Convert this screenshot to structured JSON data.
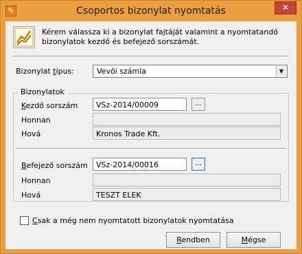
{
  "window": {
    "title": "Csoportos bizonylat nyomtatás",
    "close_glyph": "✕"
  },
  "info": {
    "icon": "chart-document-icon",
    "text": "Kérem válassza ki a bizonylat fajtáját valamint a nyomtatandó bizonylatok kezdő és befejező sorszámát."
  },
  "type_select": {
    "label_pre": "Bizonylat ",
    "label_accel": "t",
    "label_post": "ípus:",
    "value": "Vevői számla"
  },
  "group": {
    "title": "Bizonylatok",
    "start": {
      "label_accel": "K",
      "label_post": "ezdő sorszám",
      "value": "VSz-2014/00009",
      "browse_label": "...",
      "from_label": "Honnan",
      "from_value": "",
      "to_label": "Hová",
      "to_value": "Kronos Trade Kft."
    },
    "end": {
      "label_accel": "B",
      "label_post": "efejező sorszám",
      "value": "VSz-2014/00016",
      "browse_label": "...",
      "from_label": "Honnan",
      "from_value": "",
      "to_label": "Hová",
      "to_value": "TESZT ELEK"
    }
  },
  "unprinted_only": {
    "label_accel": "C",
    "label_post": "sak a még nem nyomtatott bizonylatok nyomtatása",
    "checked": false
  },
  "buttons": {
    "ok_accel": "R",
    "ok_post": "endben",
    "cancel_accel": "M",
    "cancel_post": "égse"
  },
  "colors": {
    "frame": "#e99f3e",
    "close": "#c7443a",
    "face": "#f0f0f0"
  }
}
